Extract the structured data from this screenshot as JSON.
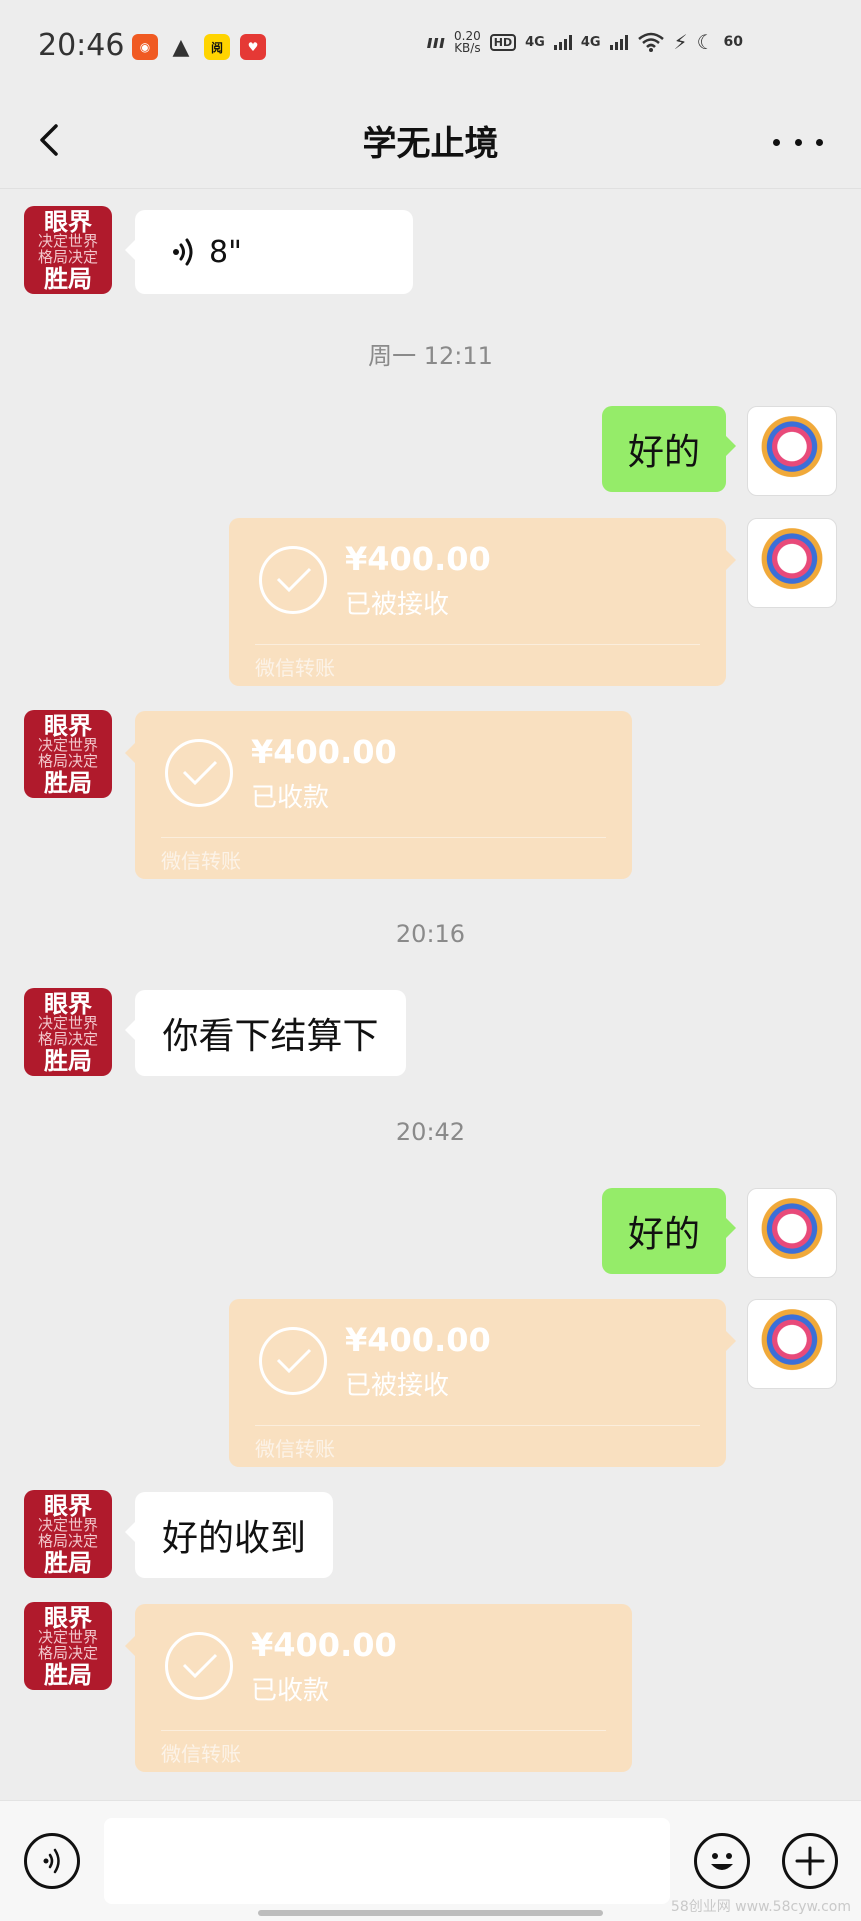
{
  "status_bar": {
    "time": "20:46",
    "net_speed_value": "0.20",
    "net_speed_unit": "KB/s",
    "hd_label": "HD",
    "sim1": "4G",
    "sim2": "4G",
    "battery": "60"
  },
  "header": {
    "title": "学无止境"
  },
  "avatar_left_text": [
    "眼界",
    "决定世界",
    "格局决定",
    "胜局"
  ],
  "messages": {
    "voice_duration": "8\"",
    "ts1": "周一 12:11",
    "msg_ok_1": "好的",
    "card1": {
      "amount": "¥400.00",
      "status": "已被接收",
      "label": "微信转账"
    },
    "card2": {
      "amount": "¥400.00",
      "status": "已收款",
      "label": "微信转账"
    },
    "ts2": "20:16",
    "msg_settle": "你看下结算下",
    "ts3": "20:42",
    "msg_ok_2": "好的",
    "card3": {
      "amount": "¥400.00",
      "status": "已被接收",
      "label": "微信转账"
    },
    "msg_received": "好的收到",
    "card4": {
      "amount": "¥400.00",
      "status": "已收款",
      "label": "微信转账"
    }
  },
  "watermark": "58创业网 www.58cyw.com",
  "colors": {
    "background": "#ededed",
    "green_bubble": "#95ec69",
    "transfer_card": "#f9e0c0",
    "avatar_red": "#b01a2c"
  },
  "icons": [
    "back-arrow-icon",
    "more-dots-icon",
    "voice-wave-icon",
    "check-icon",
    "voice-mode-icon",
    "emoji-icon",
    "plus-icon"
  ]
}
